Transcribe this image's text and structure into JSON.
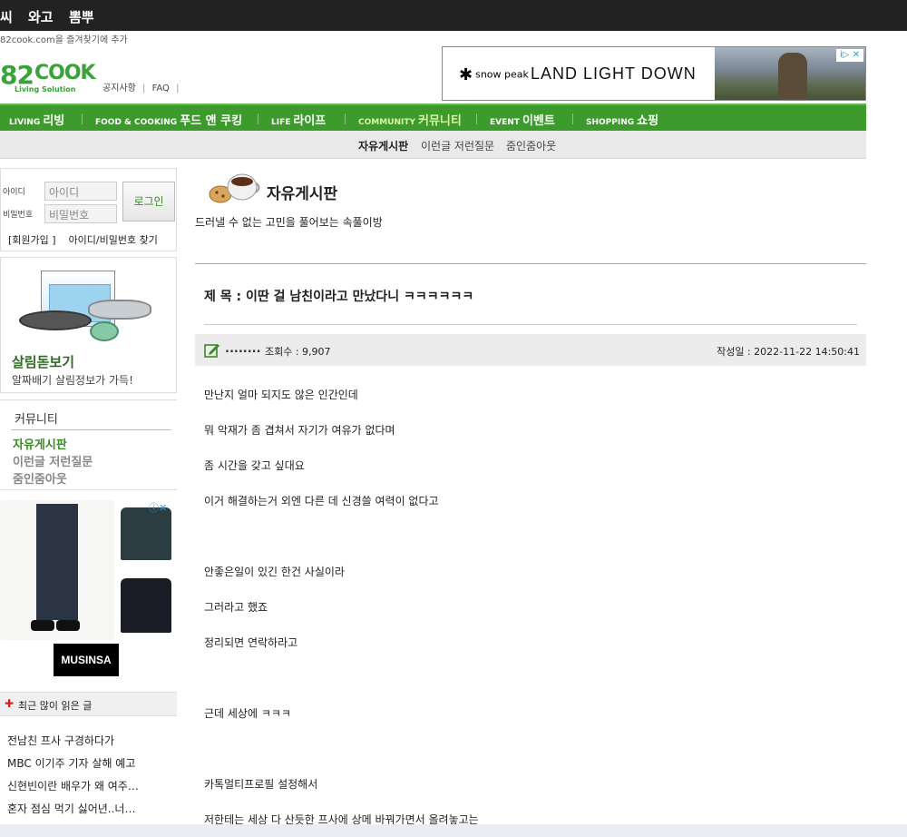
{
  "topbar": {
    "links": [
      "씨",
      "와고",
      "뽐뿌"
    ]
  },
  "bookmark_text": "82cook.com을 즐겨찾기에 추가",
  "logo": {
    "number": "82",
    "name": "COOK",
    "tagline": "Living Solution"
  },
  "toplinks": [
    "공지사항",
    "FAQ"
  ],
  "ad": {
    "brand": "snow peak",
    "headline": "LAND LIGHT DOWN",
    "badge": "i▷ ✕"
  },
  "gnb": [
    {
      "en": "LIVING",
      "ko": "리빙"
    },
    {
      "en": "FOOD & COOKING",
      "ko": "푸드 앤 쿠킹"
    },
    {
      "en": "LIFE",
      "ko": "라이프"
    },
    {
      "en": "COMMUNITY",
      "ko": "커뮤니티"
    },
    {
      "en": "EVENT",
      "ko": "이벤트"
    },
    {
      "en": "SHOPPING",
      "ko": "쇼핑"
    }
  ],
  "snb": [
    "자유게시판",
    "이런글 저런질문",
    "줌인줌아웃"
  ],
  "login": {
    "id_label": "아이디",
    "id_placeholder": "아이디",
    "pw_label": "비밀번호",
    "pw_placeholder": "비밀번호",
    "button": "로그인",
    "join": "[회원가입 ]",
    "find": "아이디/비밀번호 찾기"
  },
  "banner": {
    "title": "살림돋보기",
    "subtitle": "알짜배기 살림정보가 가득!"
  },
  "community": {
    "heading": "커뮤니티",
    "items": [
      "자유게시판",
      "이런글 저런질문",
      "줌인줌아웃"
    ]
  },
  "side_ad": {
    "brand": "MUSINSA",
    "adchoice": "ⓘ✕"
  },
  "popular": {
    "heading": "최근 많이 읽은 글",
    "items": [
      "전남친 프사 구경하다가",
      "MBC 이기주 기자 살해 예고",
      "신현빈이란 배우가 왜 여주…",
      "혼자 점심 먹기 싫어년..너…"
    ]
  },
  "board": {
    "title": "자유게시판",
    "description": "드러낼 수 없는 고민을 풀어보는 속풀이방"
  },
  "post": {
    "subject": "제 목 : 이딴 걸 남친이라고 만났다니 ㅋㅋㅋㅋㅋㅋ",
    "author": "........",
    "views": "조회수 : 9,907",
    "date": "작성일 : 2022-11-22 14:50:41",
    "lines": [
      "만난지 얼마 되지도 않은 인간인데",
      "뭐 악재가 좀 겹쳐서 자기가 여유가 없다며",
      "좀 시간을 갖고 싶대요",
      "이거 해결하는거 외엔 다른 데 신경쓸 여력이 없다고",
      "안좋은일이 있긴 한건 사실이라",
      "그러라고 했죠",
      "정리되면 연락하라고",
      "근데 세상에 ㅋㅋㅋ",
      "카톡멀티프로필 설정해서",
      "저한테는 세상 다 산듯한 프사에  상메 바꿔가면서 올려놓고는"
    ]
  }
}
